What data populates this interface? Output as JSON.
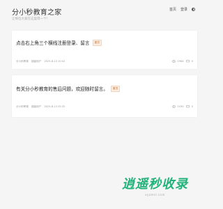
{
  "header": {
    "title": "分小秒教育之家",
    "tagline": "让每位大爱在这里得一个！",
    "nav": {
      "home_label": "首页",
      "login_label": "登录"
    }
  },
  "posts": [
    {
      "title": "点击右上角三个横线注册登录、留言",
      "badge": "置顶",
      "author": "分小秒教育",
      "author_suffix": "超级用户",
      "date": "2025-8-13 10:42",
      "views": "1964",
      "comments": "0"
    },
    {
      "title": "有关分小秒教育的售后问题，欢迎随时留言。",
      "badge": "置顶",
      "author": "分小秒教育",
      "author_suffix": "超级用户",
      "date": "2025-8-13 02:32",
      "views": "1030",
      "comments": "0"
    }
  ],
  "watermark": {
    "text": "逍遥秒收录",
    "url": "xyzmsl.com"
  },
  "colors": {
    "background": "#f5f5f5",
    "card": "#ffffff",
    "badge_text": "#c8773a",
    "badge_bg": "#fbeee2",
    "watermark": "#23b37a"
  }
}
